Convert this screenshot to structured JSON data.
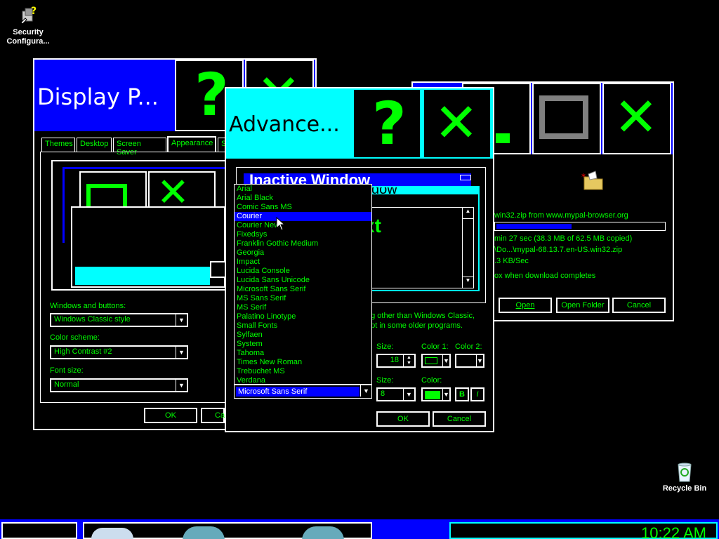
{
  "desktop": {
    "icons": [
      {
        "label": "Security Configura...",
        "icon": "security-config-icon"
      },
      {
        "label": "Recycle Bin",
        "icon": "recycle-bin-icon"
      }
    ]
  },
  "display_window": {
    "title": "Display P...",
    "tabs": [
      "Themes",
      "Desktop",
      "Screen Saver",
      "Appearance",
      "S"
    ],
    "windows_buttons_label": "Windows and buttons:",
    "windows_buttons_value": "Windows Classic style",
    "color_scheme_label": "Color scheme:",
    "color_scheme_value": "High Contrast #2",
    "font_size_label": "Font size:",
    "font_size_value": "Normal",
    "ok_label": "OK",
    "cancel_label": "Ca"
  },
  "download_window": {
    "source_text": "win32.zip from www.mypal-browser.org",
    "progress_fraction": 0.45,
    "time_text": "min 27 sec (38.3 MB of 62.5 MB copied)",
    "path_text": "\\Do...\\mypal-68.13.7.en-US.win32.zip",
    "rate_text": ".3 KB/Sec",
    "close_text": "ox when download completes",
    "open_label": "Open",
    "open_folder_label": "Open Folder",
    "cancel_label": "Cancel"
  },
  "advanced_window": {
    "title": "Advance...",
    "preview_inactive": "Inactive Window",
    "preview_active": "dow",
    "preview_text": "xt",
    "note_text_1": "ng other than Windows Classic,",
    "note_text_2": "ept in some older programs.",
    "size_label": "Size:",
    "size_value": "18",
    "color1_label": "Color 1:",
    "color2_label": "Color 2:",
    "font_size_label": "Size:",
    "font_size_value": "8",
    "color_label": "Color:",
    "bold_label": "B",
    "italic_label": "I",
    "font_value": "Microsoft Sans Serif",
    "ok_label": "OK",
    "cancel_label": "Cancel",
    "font_options": [
      "Arial",
      "Arial Black",
      "Comic Sans MS",
      "Courier",
      "Courier New",
      "Fixedsys",
      "Franklin Gothic Medium",
      "Georgia",
      "Impact",
      "Lucida Console",
      "Lucida Sans Unicode",
      "Microsoft Sans Serif",
      "MS Sans Serif",
      "MS Serif",
      "Palatino Linotype",
      "Small Fonts",
      "Sylfaen",
      "System",
      "Tahoma",
      "Times New Roman",
      "Trebuchet MS",
      "Verdana"
    ],
    "selected_font": "Courier"
  },
  "caption": {
    "help_glyph": "?",
    "close_glyph": "✕"
  },
  "taskbar": {
    "clock": "10:22 AM"
  }
}
